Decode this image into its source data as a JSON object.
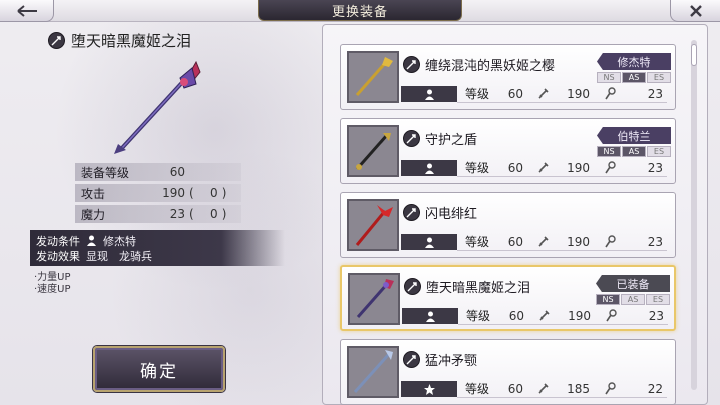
{
  "header": {
    "title": "更换装备"
  },
  "detail": {
    "name": "堕天暗黑魔姬之泪",
    "stats": [
      {
        "label": "装备等级",
        "value": "60",
        "paren_open": "",
        "bonus": "",
        "paren_close": ""
      },
      {
        "label": "攻击",
        "value": "190",
        "paren_open": "(",
        "bonus": "0",
        "paren_close": ")"
      },
      {
        "label": "魔力",
        "value": "23",
        "paren_open": "(",
        "bonus": "0",
        "paren_close": ")"
      }
    ],
    "activation_condition_label": "发动条件",
    "activation_condition_value": "修杰特",
    "activation_effect_label": "发动效果",
    "activation_effect_value": "显现　龙骑兵",
    "effects": [
      "·力量UP",
      "·速度UP"
    ],
    "confirm_label": "确定"
  },
  "list": {
    "level_label": "等级",
    "items": [
      {
        "name": "缠绕混沌的黑妖姬之樱",
        "level": "60",
        "attack": "190",
        "magic": "23",
        "owner": "修杰特",
        "flags": [
          "NS",
          "AS",
          "ES"
        ],
        "flags_on": [
          false,
          true,
          false
        ]
      },
      {
        "name": "守护之盾",
        "level": "60",
        "attack": "190",
        "magic": "23",
        "owner": "伯特兰",
        "flags": [
          "NS",
          "AS",
          "ES"
        ],
        "flags_on": [
          true,
          true,
          false
        ]
      },
      {
        "name": "闪电绯红",
        "level": "60",
        "attack": "190",
        "magic": "23",
        "owner": "",
        "flags": [],
        "flags_on": []
      },
      {
        "name": "堕天暗黑魔姬之泪",
        "level": "60",
        "attack": "190",
        "magic": "23",
        "owner": "已装备",
        "flags": [
          "NS",
          "AS",
          "ES"
        ],
        "flags_on": [
          true,
          false,
          false
        ]
      },
      {
        "name": "猛冲矛颚",
        "level": "60",
        "attack": "185",
        "magic": "22",
        "owner": "",
        "flags": [],
        "flags_on": []
      }
    ]
  },
  "colors": {
    "accent_gold": "#e9c769",
    "panel_dark": "#3c3845",
    "tag_purple": "#4a3f63"
  },
  "icons": {
    "weapon_type": "spear-icon",
    "person": "person-icon",
    "attack": "sword-icon",
    "magic": "wand-icon"
  }
}
